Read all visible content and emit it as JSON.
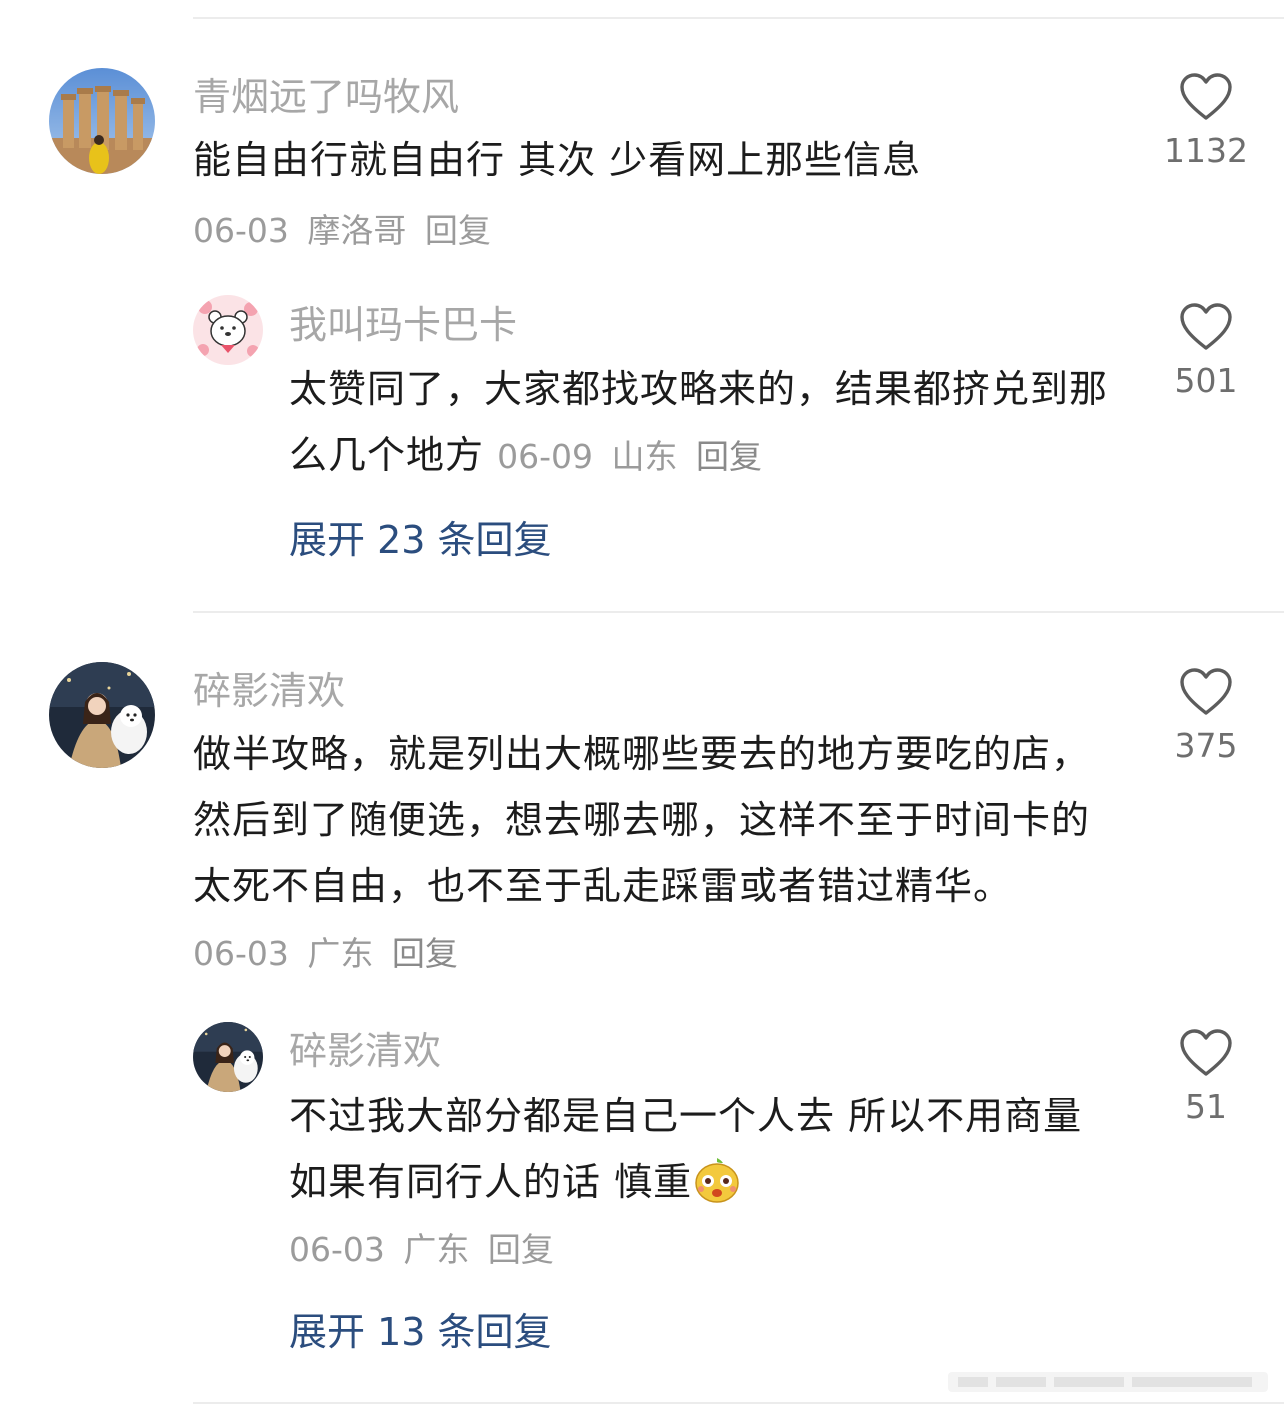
{
  "comments": [
    {
      "username": "青烟远了吗牧风",
      "text": "能自由行就自由行 其次 少看网上那些信息",
      "date": "06-03",
      "location": "摩洛哥",
      "reply_label": "回复",
      "likes": "1132",
      "avatar_icon": "temple-columns-photo-avatar",
      "replies": [
        {
          "username": "我叫玛卡巴卡",
          "text": "太赞同了，大家都找攻略来的，结果都挤兑到那么几个地方",
          "date": "06-09",
          "location": "山东",
          "reply_label": "回复",
          "likes": "501",
          "avatar_icon": "cartoon-bear-avatar"
        }
      ],
      "expand_label": "展开 23 条回复"
    },
    {
      "username": "碎影清欢",
      "text": "做半攻略，就是列出大概哪些要去的地方要吃的店，然后到了随便选，想去哪去哪，这样不至于时间卡的太死不自由，也不至于乱走踩雷或者错过精华。",
      "date": "06-03",
      "location": "广东",
      "reply_label": "回复",
      "likes": "375",
      "avatar_icon": "woman-with-dog-avatar",
      "replies": [
        {
          "username": "碎影清欢",
          "text": "不过我大部分都是自己一个人去 所以不用商量 如果有同行人的话 慎重",
          "date": "06-03",
          "location": "广东",
          "reply_label": "回复",
          "likes": "51",
          "avatar_icon": "woman-with-dog-avatar",
          "emoji_icon": "cute-face-emoji-icon"
        }
      ],
      "expand_label": "展开 13 条回复"
    }
  ],
  "colors": {
    "username": "#a7a7a7",
    "content": "#1c1c1c",
    "meta": "#9b9b9b",
    "expand_link": "#2b4d7e",
    "like_count": "#6e6e6e",
    "divider": "#ececec"
  }
}
